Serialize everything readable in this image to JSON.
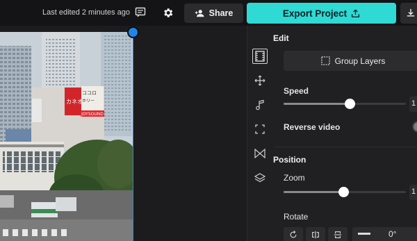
{
  "header": {
    "last_edited": "Last edited 2 minutes ago",
    "share_label": "Share",
    "export_label": "Export Project"
  },
  "colors": {
    "accent": "#2fd9d4",
    "selection": "#1f86e8",
    "background": "#1c1c1e"
  },
  "rail": {
    "icons": [
      "film-icon",
      "move-icon",
      "music-icon",
      "crop-icon",
      "transition-icon",
      "layers-icon"
    ]
  },
  "edit": {
    "title": "Edit",
    "group_layers_label": "Group Layers",
    "speed_label": "Speed",
    "speed_value": "1",
    "speed_fraction": 0.54,
    "reverse_label": "Reverse video",
    "reverse_on": false
  },
  "position": {
    "title": "Position",
    "zoom_label": "Zoom",
    "zoom_value": "1",
    "zoom_fraction": 0.49,
    "rotate_label": "Rotate",
    "rotate_value": "0°"
  },
  "canvas": {
    "signs": [
      "ココロ",
      "カネオ",
      "JOYSOUND",
      "ホリー"
    ]
  }
}
